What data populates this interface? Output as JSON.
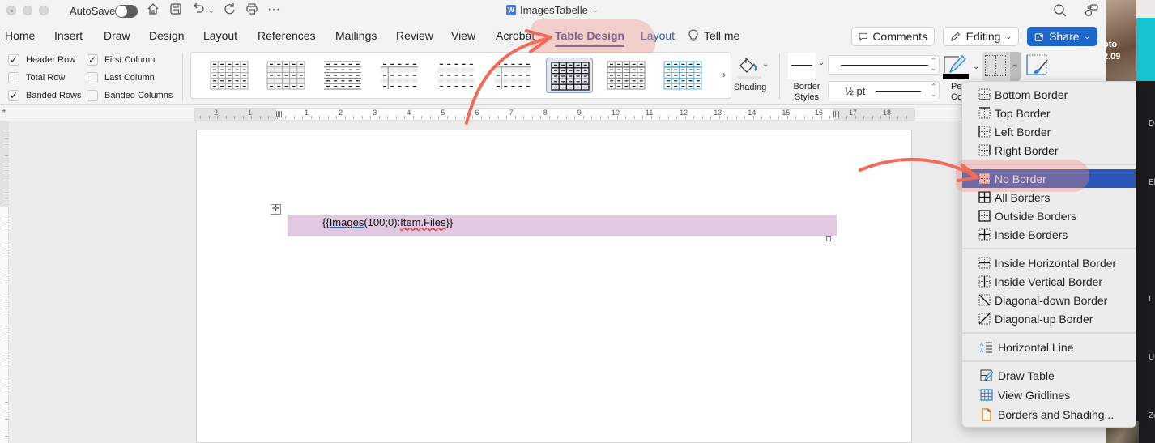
{
  "titlebar": {
    "autosave_label": "AutoSave",
    "autosave_on": false,
    "document_title": "ImagesTabelle",
    "quick_icons": [
      "home-icon",
      "save-icon",
      "undo-icon",
      "chevron-down-icon",
      "redo-icon",
      "print-icon",
      "more-icon"
    ]
  },
  "tabs": [
    {
      "label": "Home"
    },
    {
      "label": "Insert"
    },
    {
      "label": "Draw"
    },
    {
      "label": "Design"
    },
    {
      "label": "Layout"
    },
    {
      "label": "References"
    },
    {
      "label": "Mailings"
    },
    {
      "label": "Review"
    },
    {
      "label": "View"
    },
    {
      "label": "Acrobat"
    },
    {
      "label": "Table Design",
      "active": true
    },
    {
      "label": "Layout",
      "contextual": true
    }
  ],
  "tell_me": "Tell me",
  "top_buttons": {
    "comments": "Comments",
    "editing": "Editing",
    "share": "Share"
  },
  "table_style_options": [
    {
      "label": "Header Row",
      "checked": true
    },
    {
      "label": "First Column",
      "checked": true
    },
    {
      "label": "Total Row",
      "checked": false
    },
    {
      "label": "Last Column",
      "checked": false
    },
    {
      "label": "Banded Rows",
      "checked": true
    },
    {
      "label": "Banded Columns",
      "checked": false
    }
  ],
  "gallery": {
    "selected_index": 6,
    "count": 9
  },
  "shading_label": "Shading",
  "border_styles_label": "Border Styles",
  "border_styles_label_line1": "Border",
  "border_styles_label_line2": "Styles",
  "pen_weight": "½ pt",
  "pen_color_label_partial": "Pe\nCol",
  "pen_color": "#000000",
  "ruler": {
    "left_numbers": [
      "2",
      "1"
    ],
    "numbers": [
      "1",
      "2",
      "3",
      "4",
      "5",
      "6",
      "7",
      "8",
      "9",
      "10",
      "11",
      "12",
      "13",
      "14",
      "15"
    ],
    "right_numbers": [
      "16",
      "17",
      "18"
    ]
  },
  "document": {
    "cell_text_prefix": "{{",
    "cell_text_images": "Images",
    "cell_text_args": "(100;0):",
    "cell_text_item": "Item.Files",
    "cell_text_suffix": "}}",
    "cell_shading": "#e0c9e0"
  },
  "border_menu": {
    "groups": [
      [
        {
          "label": "Bottom Border",
          "icon": "bottom-border-icon"
        },
        {
          "label": "Top Border",
          "icon": "top-border-icon"
        },
        {
          "label": "Left Border",
          "icon": "left-border-icon"
        },
        {
          "label": "Right Border",
          "icon": "right-border-icon"
        }
      ],
      [
        {
          "label": "No Border",
          "icon": "no-border-icon",
          "highlighted": true
        },
        {
          "label": "All Borders",
          "icon": "all-borders-icon"
        },
        {
          "label": "Outside Borders",
          "icon": "outside-borders-icon"
        },
        {
          "label": "Inside Borders",
          "icon": "inside-borders-icon"
        }
      ],
      [
        {
          "label": "Inside Horizontal Border",
          "icon": "inside-horizontal-border-icon"
        },
        {
          "label": "Inside Vertical Border",
          "icon": "inside-vertical-border-icon"
        },
        {
          "label": "Diagonal-down Border",
          "icon": "diagonal-down-border-icon"
        },
        {
          "label": "Diagonal-up Border",
          "icon": "diagonal-up-border-icon"
        }
      ],
      [
        {
          "label": "Horizontal Line",
          "icon": "horizontal-line-icon"
        }
      ],
      [
        {
          "label": "Draw Table",
          "icon": "draw-table-icon"
        },
        {
          "label": "View Gridlines",
          "icon": "view-gridlines-icon"
        },
        {
          "label": "Borders and Shading...",
          "icon": "borders-shading-icon"
        }
      ]
    ]
  },
  "side_panel": {
    "photo_text_line1": "oto",
    "photo_text_line2": "2.09",
    "labels": [
      "D",
      "El",
      "I",
      "U",
      "Ze"
    ]
  },
  "colors": {
    "accent_tab": "#46478a",
    "share_blue": "#1f66c9",
    "menu_highlight": "#2a56b8",
    "annotation": "#ef6b5a"
  }
}
